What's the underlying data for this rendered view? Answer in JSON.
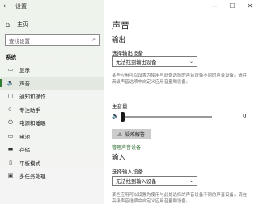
{
  "window": {
    "title": "设置",
    "back_glyph": "←",
    "minimize_glyph": "—",
    "maximize_glyph": "☐",
    "close_glyph": "✕"
  },
  "sidebar": {
    "home_label": "主页",
    "home_icon": "home-icon",
    "search_placeholder": "查找设置",
    "section_label": "系统",
    "items": [
      {
        "label": "显示",
        "icon": "monitor-icon",
        "glyph": "▭"
      },
      {
        "label": "声音",
        "icon": "speaker-icon",
        "glyph": "🔈"
      },
      {
        "label": "通知和操作",
        "icon": "notification-icon",
        "glyph": "▢"
      },
      {
        "label": "专注助手",
        "icon": "moon-icon",
        "glyph": "☾"
      },
      {
        "label": "电源和睡眠",
        "icon": "power-icon",
        "glyph": "⏻"
      },
      {
        "label": "电池",
        "icon": "battery-icon",
        "glyph": "▭"
      },
      {
        "label": "存储",
        "icon": "storage-icon",
        "glyph": "▬"
      },
      {
        "label": "平板模式",
        "icon": "tablet-icon",
        "glyph": "▯"
      },
      {
        "label": "多任务处理",
        "icon": "multitask-icon",
        "glyph": "▣"
      }
    ],
    "active_index": 1,
    "accent_color": "#2d7d32"
  },
  "main": {
    "title": "声音",
    "output": {
      "heading": "输出",
      "select_label": "选择输出设备",
      "select_value": "无法找到输出设备",
      "description": "某些应用可以设置为使用与此处选择的声音设备不同的声音设备。请在高级声音选项中自定义应用音量和设备。",
      "volume_label": "主音量",
      "volume_value": "0",
      "volume_level": 0,
      "troubleshoot_label": "疑难解答",
      "manage_link": "管理声音设备"
    },
    "input": {
      "heading": "输入",
      "select_label": "选择输入设备",
      "select_value": "无法找到输入设备",
      "description": "某些应用可以设置为使用与此处选择的声音设备不同的声音设备。请在高级声音选项中自定义应用音量和设备。"
    }
  }
}
